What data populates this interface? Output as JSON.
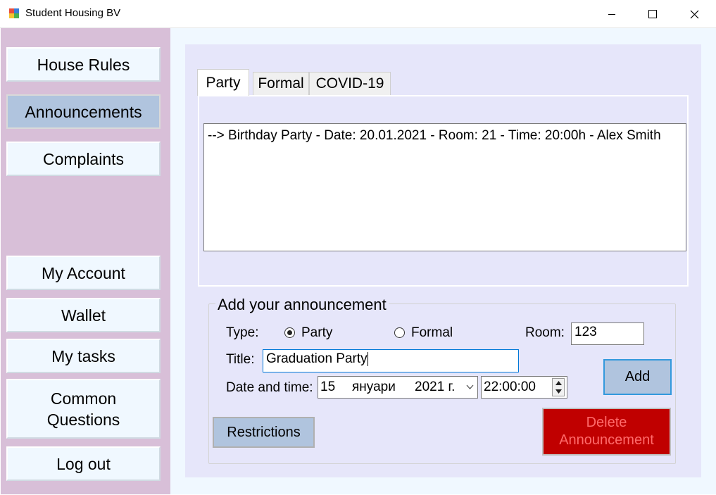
{
  "window": {
    "title": "Student Housing BV",
    "minimize_glyph": "—",
    "maximize_glyph": "☐",
    "close_glyph": "✕"
  },
  "sidebar": {
    "items": [
      {
        "label": "House Rules"
      },
      {
        "label": "Announcements",
        "active": true
      },
      {
        "label": "Complaints"
      },
      {
        "label": "My Account"
      },
      {
        "label": "Wallet"
      },
      {
        "label": "My tasks"
      },
      {
        "label": "Common Questions"
      },
      {
        "label": "Log out"
      }
    ]
  },
  "tabs": [
    {
      "label": "Party",
      "active": true
    },
    {
      "label": "Formal"
    },
    {
      "label": "COVID-19"
    }
  ],
  "list": {
    "items": [
      "--> Birthday Party - Date: 20.01.2021 - Room: 21 - Time: 20:00h - Alex Smith"
    ]
  },
  "form": {
    "group_title": "Add your announcement",
    "type_label": "Type:",
    "type_options": [
      {
        "label": "Party",
        "checked": true
      },
      {
        "label": "Formal",
        "checked": false
      }
    ],
    "room_label": "Room:",
    "room_value": "123",
    "title_label": "Title:",
    "title_value": "Graduation Party",
    "date_label": "Date and time:",
    "date_day": "15",
    "date_month": "януари",
    "date_year": "2021 г.",
    "time_value": "22:00:00",
    "add_label": "Add",
    "restrictions_label": "Restrictions",
    "delete_label": "Delete Announcement"
  },
  "colors": {
    "sidebar_bg": "#d8bfd8",
    "panel_bg": "#e6e6fa",
    "main_bg": "#f0f8ff",
    "button_bg": "#b0c4de",
    "delete_bg": "#c00000",
    "delete_text": "#ff6b6b"
  }
}
